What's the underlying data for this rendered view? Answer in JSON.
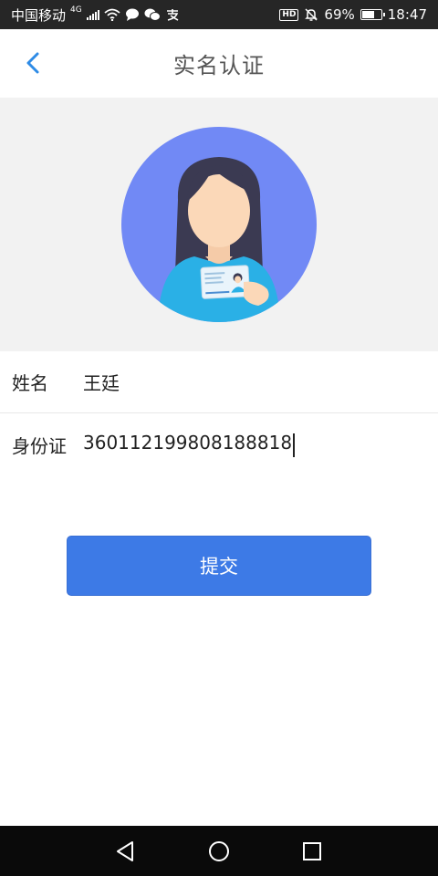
{
  "status_bar": {
    "carrier": "中国移动",
    "network": "4G",
    "battery_percent": "69%",
    "battery_level": 0.69,
    "time": "18:47",
    "hd_label": "HD",
    "icons": [
      "signal-icon",
      "wifi-icon",
      "chat-bubble-icon",
      "wechat-icon",
      "alipay-icon",
      "hd-icon",
      "mute-bell-icon",
      "battery-icon"
    ]
  },
  "header": {
    "title": "实名认证",
    "back_icon": "chevron-left-icon"
  },
  "hero": {
    "illustration": "woman-holding-id-card-illustration",
    "circle_color": "#7189f5"
  },
  "form": {
    "name_label": "姓名",
    "name_value": "王廷",
    "id_label": "身份证",
    "id_value": "360112199808188818"
  },
  "submit": {
    "label": "提交",
    "color": "#3d7ae6"
  },
  "system_nav": {
    "back_icon": "triangle-back-icon",
    "home_icon": "circle-home-icon",
    "recents_icon": "square-recents-icon"
  },
  "colors": {
    "accent": "#2e8be6",
    "hero_bg": "#f2f2f2",
    "status_bar_bg": "#262626"
  }
}
